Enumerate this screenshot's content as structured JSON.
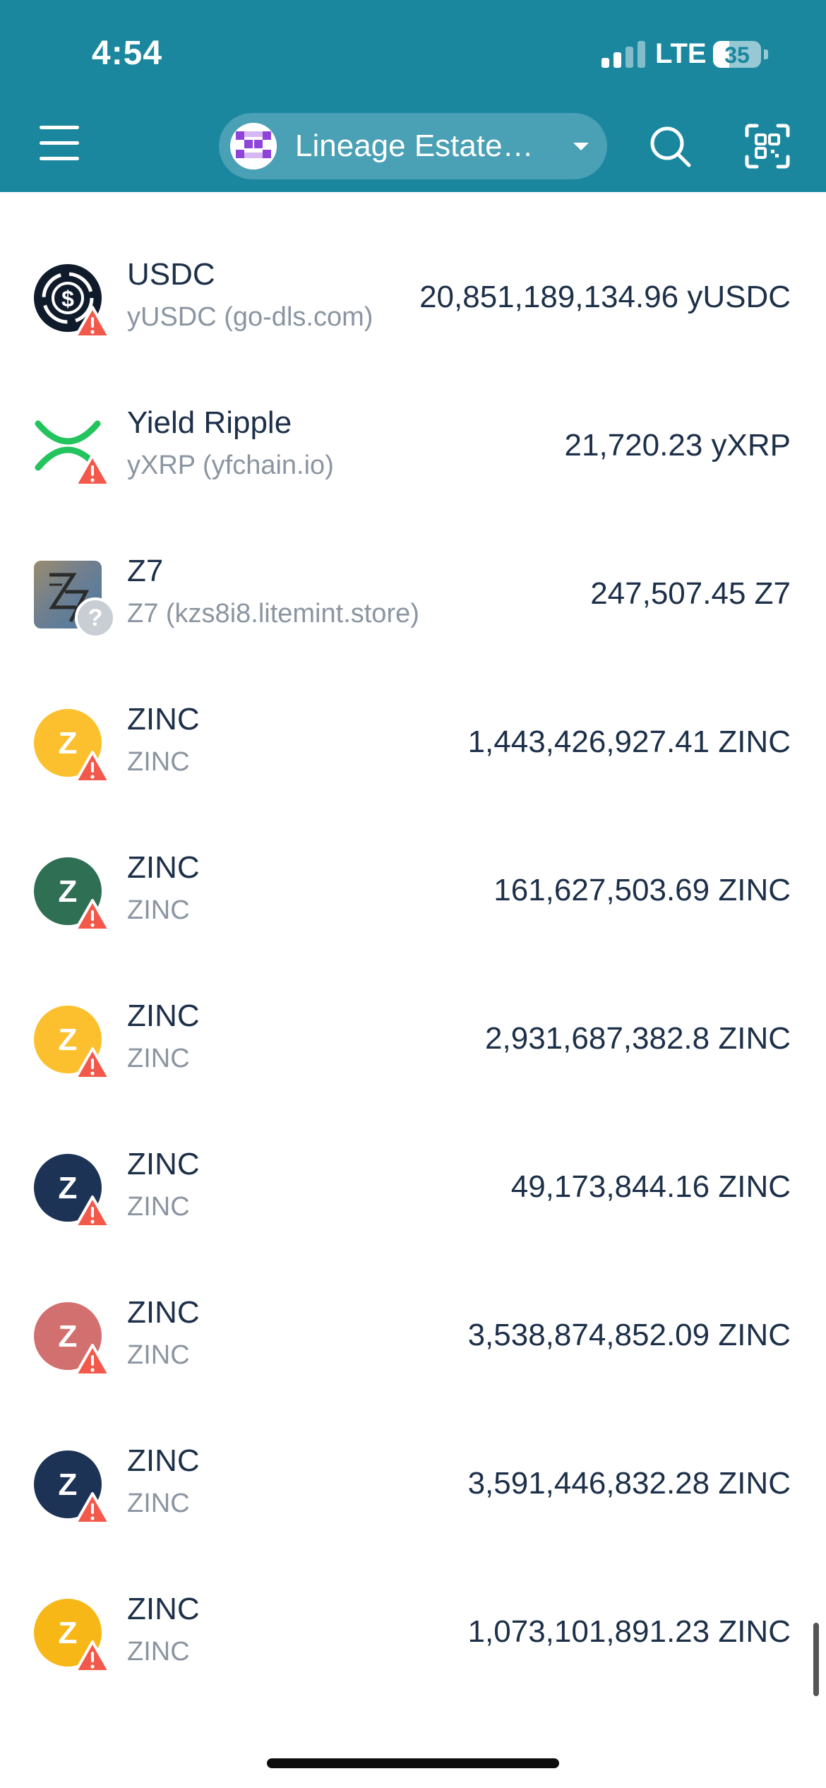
{
  "status_bar": {
    "time": "4:54",
    "network": "LTE",
    "battery": "35"
  },
  "header": {
    "wallet_name": "Lineage Estate…",
    "icons": {
      "menu": "hamburger-menu-icon",
      "search": "search-icon",
      "scan": "qr-scan-icon",
      "dropdown": "chevron-down-icon"
    },
    "colors": {
      "bar": "#1a879f",
      "pill": "#4aa0b4"
    }
  },
  "tokens": [
    {
      "name": "USDC",
      "subtitle": "yUSDC (go-dls.com)",
      "amount": "20,851,189,134.96 yUSDC",
      "icon": "usdc-icon",
      "badge": "warning"
    },
    {
      "name": "Yield Ripple",
      "subtitle": "yXRP (yfchain.io)",
      "amount": "21,720.23 yXRP",
      "icon": "xrp-icon",
      "badge": "warning"
    },
    {
      "name": "Z7",
      "subtitle": "Z7 (kzs8i8.litemint.store)",
      "amount": "247,507.45 Z7",
      "icon": "z7-icon",
      "badge": "unknown"
    },
    {
      "name": "ZINC",
      "subtitle": "ZINC",
      "amount": "1,443,426,927.41 ZINC",
      "icon": "zinc-icon",
      "color": "#fcc02e",
      "badge": "warning"
    },
    {
      "name": "ZINC",
      "subtitle": "ZINC",
      "amount": "161,627,503.69 ZINC",
      "icon": "zinc-icon",
      "color": "#2f7055",
      "badge": "warning"
    },
    {
      "name": "ZINC",
      "subtitle": "ZINC",
      "amount": "2,931,687,382.8 ZINC",
      "icon": "zinc-icon",
      "color": "#fcc02e",
      "badge": "warning"
    },
    {
      "name": "ZINC",
      "subtitle": "ZINC",
      "amount": "49,173,844.16 ZINC",
      "icon": "zinc-icon",
      "color": "#1c3355",
      "badge": "warning"
    },
    {
      "name": "ZINC",
      "subtitle": "ZINC",
      "amount": "3,538,874,852.09 ZINC",
      "icon": "zinc-icon",
      "color": "#d2706f",
      "badge": "warning"
    },
    {
      "name": "ZINC",
      "subtitle": "ZINC",
      "amount": "3,591,446,832.28 ZINC",
      "icon": "zinc-icon",
      "color": "#1c3355",
      "badge": "warning"
    },
    {
      "name": "ZINC",
      "subtitle": "ZINC",
      "amount": "1,073,101,891.23 ZINC",
      "icon": "zinc-icon",
      "color": "#f7b716",
      "badge": "warning"
    }
  ],
  "zinc_letter": "Z",
  "warning_color": "#f2594b"
}
